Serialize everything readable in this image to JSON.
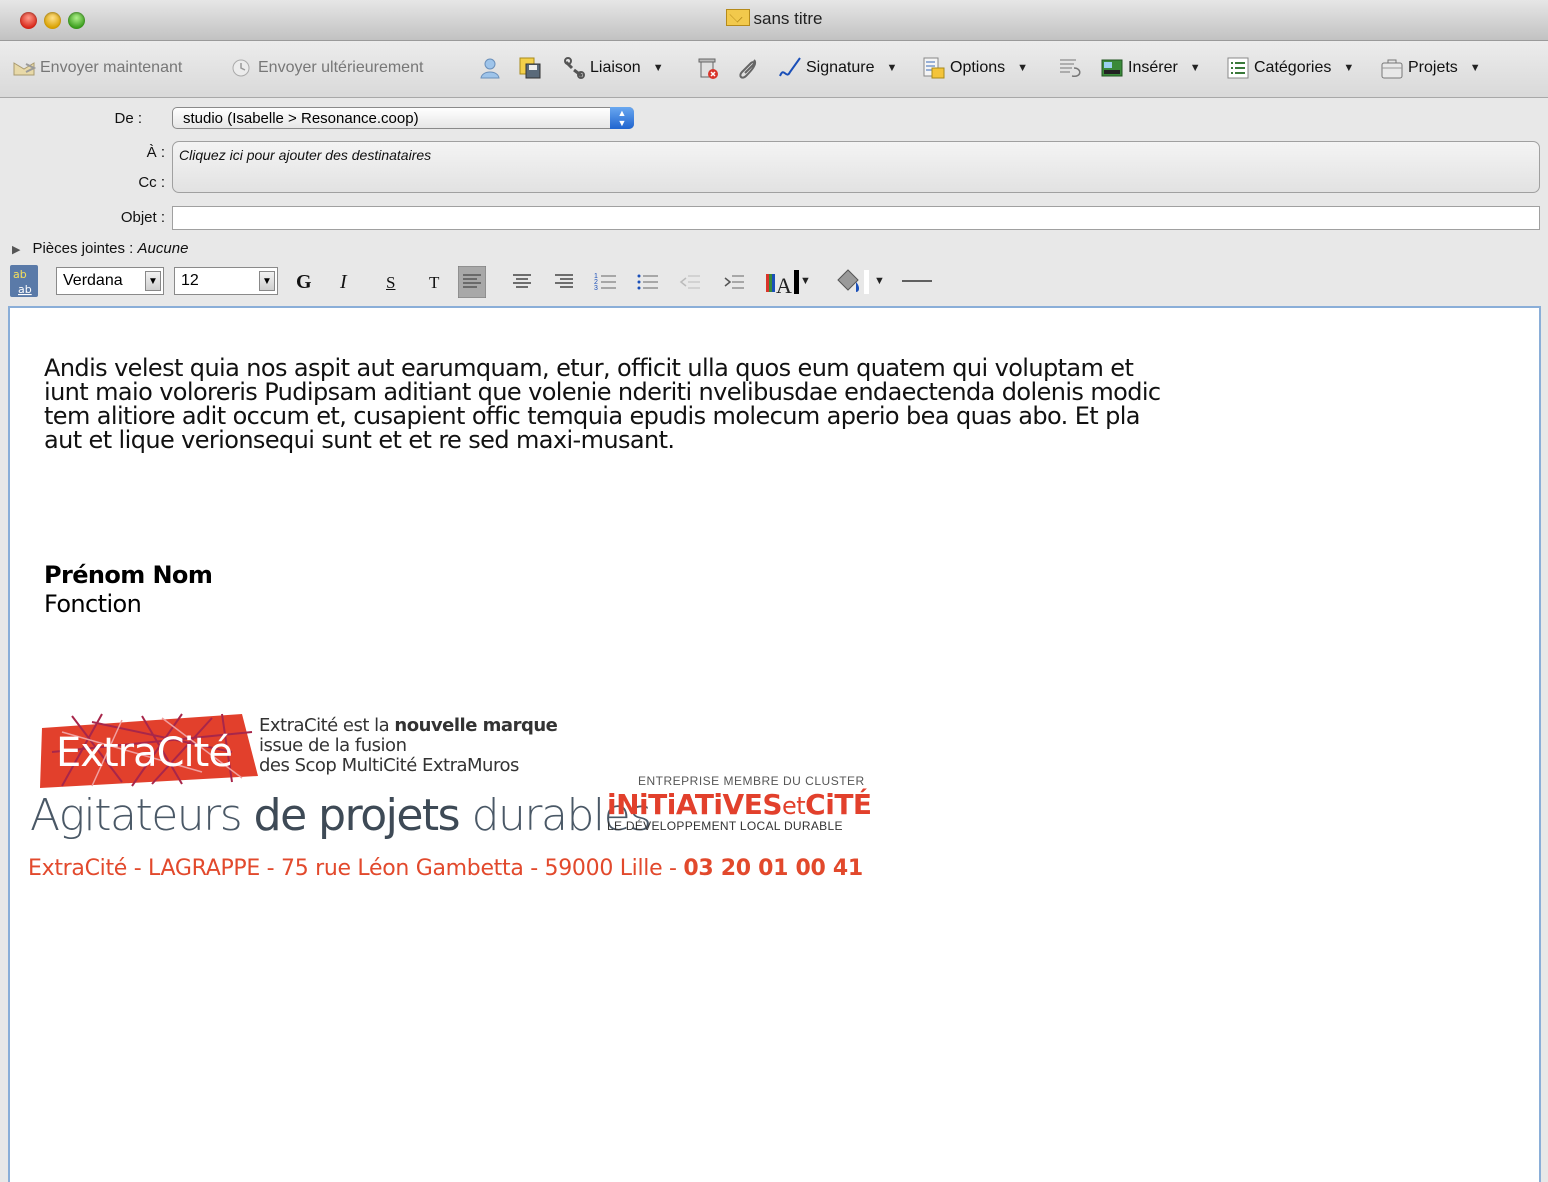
{
  "window": {
    "title": "sans titre"
  },
  "toolbar": {
    "send_now": "Envoyer maintenant",
    "send_later": "Envoyer ultérieurement",
    "link": "Liaison",
    "signature": "Signature",
    "options": "Options",
    "insert": "Insérer",
    "categories": "Catégories",
    "projects": "Projets"
  },
  "header": {
    "from_label": "De :",
    "from_value": "studio (Isabelle > Resonance.coop)",
    "to_label": "À :",
    "to_placeholder": "Cliquez ici pour ajouter des destinataires",
    "cc_label": "Cc :",
    "subject_label": "Objet :",
    "subject_value": "",
    "attachments_label": "Pièces jointes :",
    "attachments_value": "Aucune"
  },
  "format": {
    "font": "Verdana",
    "size": "12",
    "bold": "G",
    "italic": "I",
    "underline": "S",
    "text": "T"
  },
  "message": {
    "body": "Andis velest quia nos aspit aut earumquam, etur, officit ulla quos eum quatem qui voluptam et iunt maio voloreris Pudipsam aditiant que volenie nderiti nvelibusdae endaectenda dolenis modic tem alitiore adit occum et, cusapient offic temquia epudis molecum aperio bea quas abo. Et pla aut et lique verionsequi sunt et et re sed maxi-musant.",
    "signature_name": "Prénom Nom",
    "signature_function": "Fonction"
  },
  "signature_block": {
    "logo_text": "ExtraCité",
    "desc_line1_a": "ExtraCité est la ",
    "desc_line1_b": "nouvelle marque",
    "desc_line2": "issue de la fusion",
    "desc_line3": "des Scop MultiCité ExtraMuros",
    "tagline_a": "Agitateurs ",
    "tagline_b": "de projets",
    "tagline_c": " durables",
    "cluster_label": "ENTREPRISE MEMBRE DU CLUSTER",
    "cluster_name_a": "iNiTiATiVES",
    "cluster_name_b": "et",
    "cluster_name_c": "CiTÉ",
    "cluster_sub": "LE DÉVELOPPEMENT LOCAL DURABLE",
    "address": "ExtraCité - LAGRAPPE - 75 rue Léon Gambetta - 59000 Lille - ",
    "phone": "03 20 01 00 41"
  },
  "colors": {
    "accent_orange": "#e2492c",
    "selection_blue": "#8aaed8"
  }
}
